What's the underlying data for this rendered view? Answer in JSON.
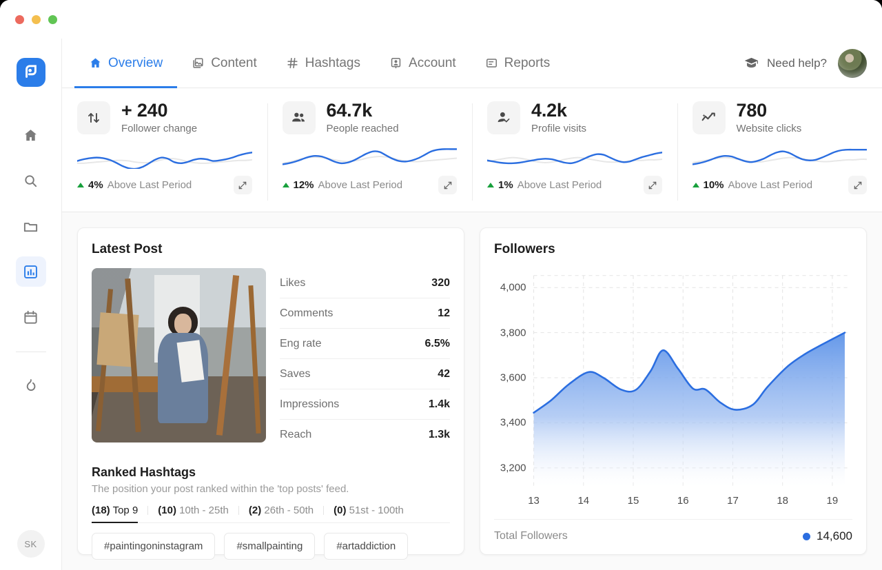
{
  "window": {
    "lights": [
      "close",
      "minimize",
      "zoom"
    ]
  },
  "sidebar": {
    "logo_name": "app-logo",
    "items": [
      {
        "name": "home",
        "icon": "home-icon",
        "active": false
      },
      {
        "name": "search",
        "icon": "search-icon",
        "active": false
      },
      {
        "name": "folders",
        "icon": "folder-icon",
        "active": false
      },
      {
        "name": "analytics",
        "icon": "bar-chart-icon",
        "active": true
      },
      {
        "name": "calendar",
        "icon": "calendar-icon",
        "active": false
      },
      {
        "name": "trending",
        "icon": "flame-icon",
        "active": false
      }
    ],
    "user_initials": "SK"
  },
  "topnav": {
    "tabs": [
      {
        "label": "Overview",
        "icon": "home-icon",
        "active": true
      },
      {
        "label": "Content",
        "icon": "image-stack-icon",
        "active": false
      },
      {
        "label": "Hashtags",
        "icon": "hash-icon",
        "active": false
      },
      {
        "label": "Account",
        "icon": "account-badge-icon",
        "active": false
      },
      {
        "label": "Reports",
        "icon": "report-list-icon",
        "active": false
      }
    ],
    "help_label": "Need help?",
    "help_icon": "graduation-cap-icon",
    "avatar": "user-avatar"
  },
  "stats": [
    {
      "value": "+ 240",
      "label": "Follower change",
      "icon": "up-down-arrows-icon",
      "delta_pct": "4%",
      "delta_text": "Above Last Period",
      "direction": "up",
      "spark": [
        30,
        27,
        25,
        24,
        25,
        28,
        33,
        39,
        43,
        44,
        41,
        35,
        28,
        24,
        26,
        32,
        34,
        32,
        28,
        26,
        27,
        30,
        29,
        27,
        24,
        20,
        17,
        15
      ],
      "spark_prev": [
        34,
        34,
        33,
        32,
        31,
        30,
        29,
        29,
        30,
        32,
        33,
        33,
        31,
        28,
        26,
        26,
        28,
        31,
        33,
        34,
        34,
        33,
        32,
        31,
        30,
        29,
        29,
        28
      ]
    },
    {
      "value": "64.7k",
      "label": "People reached",
      "icon": "people-icon",
      "delta_pct": "12%",
      "delta_text": "Above Last Period",
      "direction": "up",
      "spark": [
        36,
        34,
        31,
        27,
        23,
        21,
        22,
        26,
        31,
        34,
        33,
        29,
        23,
        17,
        13,
        14,
        20,
        26,
        30,
        31,
        29,
        25,
        19,
        13,
        10,
        9,
        9,
        9
      ],
      "spark_prev": [
        34,
        32,
        29,
        26,
        24,
        23,
        24,
        26,
        28,
        30,
        31,
        30,
        28,
        25,
        23,
        22,
        23,
        25,
        28,
        30,
        31,
        31,
        30,
        29,
        28,
        27,
        26,
        25
      ]
    },
    {
      "value": "4.2k",
      "label": "Profile visits",
      "icon": "person-check-icon",
      "delta_pct": "1%",
      "delta_text": "Above Last Period",
      "direction": "up",
      "spark": [
        29,
        31,
        33,
        34,
        34,
        33,
        31,
        29,
        27,
        26,
        27,
        30,
        33,
        34,
        31,
        26,
        21,
        18,
        19,
        24,
        29,
        32,
        31,
        27,
        23,
        20,
        17,
        15
      ],
      "spark_prev": [
        31,
        29,
        27,
        25,
        24,
        25,
        27,
        30,
        32,
        33,
        32,
        30,
        27,
        25,
        24,
        25,
        27,
        29,
        31,
        32,
        32,
        31,
        30,
        29,
        29,
        28,
        28,
        27
      ]
    },
    {
      "value": "780",
      "label": "Website clicks",
      "icon": "trend-sparkle-icon",
      "delta_pct": "10%",
      "delta_text": "Above Last Period",
      "direction": "up",
      "spark": [
        36,
        34,
        31,
        27,
        23,
        21,
        22,
        26,
        30,
        32,
        30,
        26,
        20,
        15,
        13,
        16,
        22,
        27,
        29,
        28,
        24,
        19,
        14,
        11,
        10,
        10,
        10,
        10
      ],
      "spark_prev": [
        33,
        31,
        29,
        27,
        25,
        24,
        25,
        27,
        29,
        31,
        32,
        31,
        29,
        27,
        25,
        24,
        25,
        26,
        28,
        30,
        31,
        31,
        30,
        29,
        28,
        28,
        27,
        27
      ]
    }
  ],
  "latest_post": {
    "title": "Latest Post",
    "image_name": "latest-post-thumbnail",
    "metrics": [
      {
        "key": "Likes",
        "value": "320"
      },
      {
        "key": "Comments",
        "value": "12"
      },
      {
        "key": "Eng rate",
        "value": "6.5%"
      },
      {
        "key": "Saves",
        "value": "42"
      },
      {
        "key": "Impressions",
        "value": "1.4k"
      },
      {
        "key": "Reach",
        "value": "1.3k"
      }
    ]
  },
  "ranked_hashtags": {
    "title": "Ranked Hashtags",
    "subtitle": "The position your post ranked within the 'top posts' feed.",
    "tabs": [
      {
        "count": "(18)",
        "label": "Top 9",
        "active": true
      },
      {
        "count": "(10)",
        "label": "10th - 25th",
        "active": false
      },
      {
        "count": "(2)",
        "label": "26th - 50th",
        "active": false
      },
      {
        "count": "(0)",
        "label": "51st - 100th",
        "active": false
      }
    ],
    "chips": [
      "#paintingoninstagram",
      "#smallpainting",
      "#artaddiction"
    ]
  },
  "followers_panel": {
    "title": "Followers",
    "total_label": "Total Followers",
    "total_value": "14,600",
    "legend_color": "#2b6ee0"
  },
  "chart_data": {
    "type": "area",
    "title": "Followers",
    "xlabel": "",
    "ylabel": "",
    "x": [
      13,
      14,
      15,
      16,
      17,
      18,
      19
    ],
    "tick_labels": [
      "13",
      "14",
      "15",
      "16",
      "17",
      "18",
      "19"
    ],
    "ytick_labels": [
      "3,200",
      "3,400",
      "3,600",
      "3,800",
      "4,000"
    ],
    "yticks": [
      3200,
      3400,
      3600,
      3800,
      4000
    ],
    "ylim": [
      3120,
      4060
    ],
    "xlim": [
      13,
      19.3
    ],
    "grid": "dashed",
    "legend_position": "bottom-right",
    "series": [
      {
        "name": "Followers",
        "color": "#2b6ee0",
        "fill": "gradient-blue",
        "points": [
          {
            "x": 13.0,
            "y": 3445
          },
          {
            "x": 13.35,
            "y": 3500
          },
          {
            "x": 13.7,
            "y": 3570
          },
          {
            "x": 14.1,
            "y": 3625
          },
          {
            "x": 14.4,
            "y": 3600
          },
          {
            "x": 14.75,
            "y": 3548
          },
          {
            "x": 15.05,
            "y": 3546
          },
          {
            "x": 15.35,
            "y": 3630
          },
          {
            "x": 15.6,
            "y": 3722
          },
          {
            "x": 15.9,
            "y": 3640
          },
          {
            "x": 16.2,
            "y": 3552
          },
          {
            "x": 16.45,
            "y": 3548
          },
          {
            "x": 16.75,
            "y": 3490
          },
          {
            "x": 17.05,
            "y": 3458
          },
          {
            "x": 17.4,
            "y": 3480
          },
          {
            "x": 17.7,
            "y": 3560
          },
          {
            "x": 18.1,
            "y": 3650
          },
          {
            "x": 18.45,
            "y": 3705
          },
          {
            "x": 18.8,
            "y": 3748
          },
          {
            "x": 19.25,
            "y": 3800
          }
        ]
      }
    ]
  }
}
